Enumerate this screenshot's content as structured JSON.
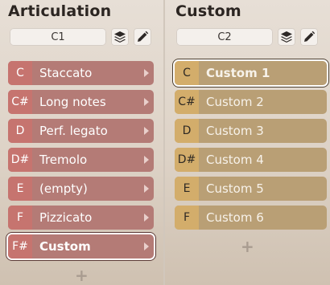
{
  "articulation": {
    "title": "Articulation",
    "slot": "C1",
    "rows": [
      {
        "key": "C",
        "label": "Staccato"
      },
      {
        "key": "C#",
        "label": "Long notes"
      },
      {
        "key": "D",
        "label": "Perf. legato"
      },
      {
        "key": "D#",
        "label": "Tremolo"
      },
      {
        "key": "E",
        "label": "(empty)"
      },
      {
        "key": "F",
        "label": "Pizzicato"
      },
      {
        "key": "F#",
        "label": "Custom"
      }
    ],
    "add_label": "+"
  },
  "custom": {
    "title": "Custom",
    "slot": "C2",
    "rows": [
      {
        "key": "C",
        "label": "Custom 1"
      },
      {
        "key": "C#",
        "label": "Custom 2"
      },
      {
        "key": "D",
        "label": "Custom 3"
      },
      {
        "key": "D#",
        "label": "Custom 4"
      },
      {
        "key": "E",
        "label": "Custom 5"
      },
      {
        "key": "F",
        "label": "Custom 6"
      }
    ],
    "add_label": "+"
  },
  "icons": {
    "layers": "layers-icon",
    "edit": "pencil-icon",
    "arrow": "chevron-right-icon"
  },
  "colors": {
    "articulation_row": "#b47b76",
    "articulation_key": "#c6746f",
    "custom_row": "#b99f75",
    "custom_key": "#d3ad6b"
  }
}
